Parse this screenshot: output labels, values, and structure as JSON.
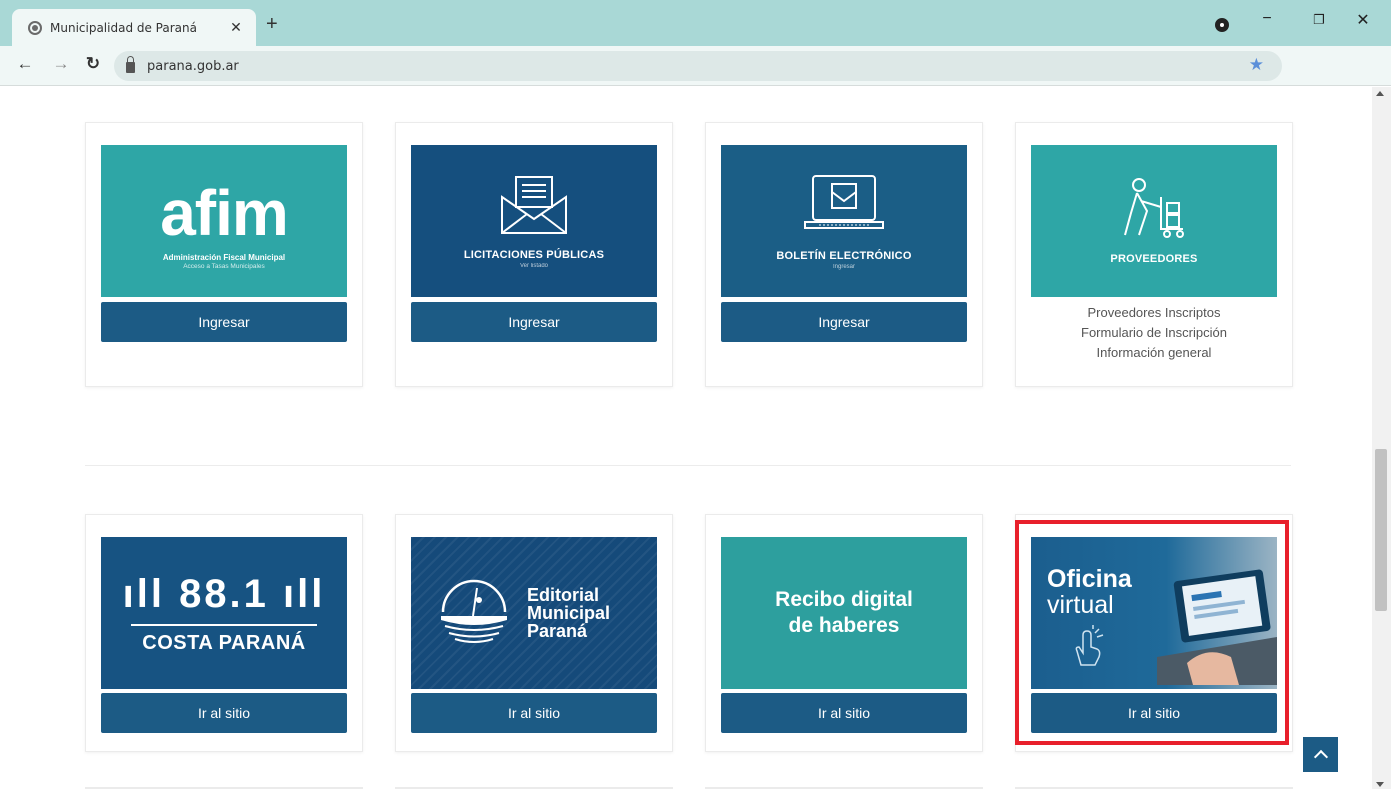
{
  "browser": {
    "tab_title": "Municipalidad de Paraná",
    "url": "parana.gob.ar"
  },
  "cards_row1": [
    {
      "id": "afim",
      "logo": "afim",
      "subtitle": "Administración Fiscal Municipal",
      "subtitle2": "Acceso a Tasas Municipales",
      "button": "Ingresar"
    },
    {
      "id": "licitaciones",
      "title": "LICITACIONES PÚBLICAS",
      "subtitle": "Ver listado",
      "button": "Ingresar"
    },
    {
      "id": "boletin",
      "title": "BOLETÍN ELECTRÓNICO",
      "subtitle": "Ingresar",
      "button": "Ingresar"
    },
    {
      "id": "proveedores",
      "title": "PROVEEDORES",
      "links": [
        "Proveedores Inscriptos",
        "Formulario de Inscripción",
        "Información general"
      ]
    }
  ],
  "cards_row2": [
    {
      "id": "radio",
      "freq": "88.1",
      "name": "COSTA PARANÁ",
      "button": "Ir al sitio"
    },
    {
      "id": "editorial",
      "line1": "Editorial",
      "line2": "Municipal",
      "line3": "Paraná",
      "button": "Ir al sitio"
    },
    {
      "id": "recibo",
      "line1": "Recibo digital",
      "line2": "de haberes",
      "button": "Ir al sitio"
    },
    {
      "id": "oficina",
      "line1": "Oficina",
      "line2": "virtual",
      "button": "Ir al sitio"
    }
  ],
  "colors": {
    "teal": "#2ea6a6",
    "navy": "#154f7e",
    "button": "#1c5b85",
    "highlight": "#e8202b",
    "tabbar": "#a9d8d6"
  }
}
